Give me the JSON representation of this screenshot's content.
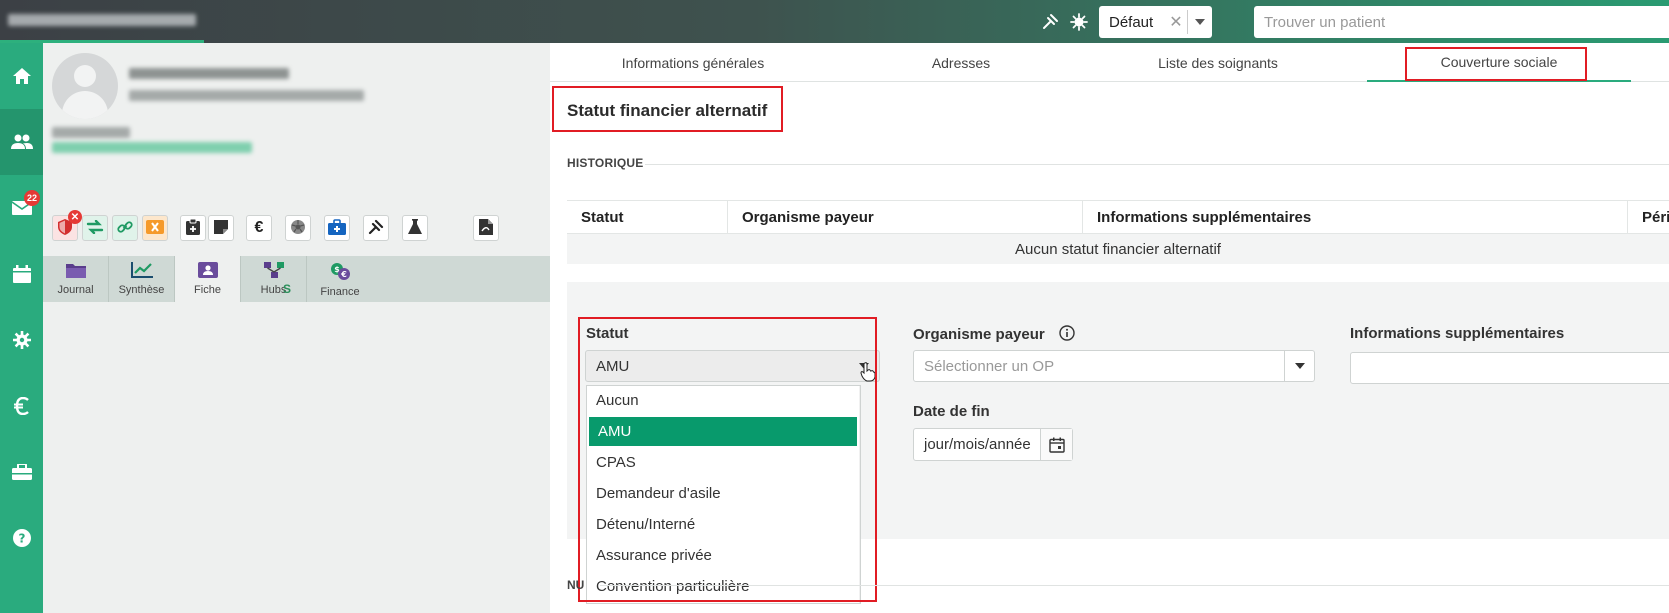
{
  "topbar": {
    "defaut_value": "Défaut",
    "patient_search_placeholder": "Trouver un patient"
  },
  "leftnav": {
    "items": [
      {
        "icon": "home-icon"
      },
      {
        "icon": "users-icon",
        "active": true
      },
      {
        "icon": "mail-icon",
        "badge": "22"
      },
      {
        "icon": "calendar-icon"
      },
      {
        "icon": "gear-icon"
      },
      {
        "icon": "euro-icon"
      },
      {
        "icon": "toolbox-icon"
      },
      {
        "icon": "help-icon"
      }
    ]
  },
  "patient_tabs": [
    {
      "label": "Journal",
      "icon": "folder-icon"
    },
    {
      "label": "Synthèse",
      "icon": "chart-icon"
    },
    {
      "label": "Fiche",
      "icon": "id-card-icon",
      "active": true
    },
    {
      "label": "Hubs",
      "icon": "hub-icon",
      "suffix": "S"
    },
    {
      "label": "Finance",
      "icon": "finance-icon"
    }
  ],
  "patient_actions": {
    "euro_label": "€",
    "shield_badge": "✕"
  },
  "main_tabs": [
    {
      "label": "Informations générales"
    },
    {
      "label": "Adresses"
    },
    {
      "label": "Liste des soignants"
    },
    {
      "label": "Couverture sociale",
      "active": true
    }
  ],
  "section": {
    "title": "Statut financier alternatif",
    "historique_label": "HISTORIQUE"
  },
  "history_table": {
    "columns": [
      "Statut",
      "Organisme payeur",
      "Informations supplémentaires",
      "Péri"
    ],
    "empty_message": "Aucun statut financier alternatif"
  },
  "form": {
    "statut_label": "Statut",
    "statut_value": "AMU",
    "organisme_label": "Organisme payeur",
    "organisme_placeholder": "Sélectionner un OP",
    "info_label": "Informations supplémentaires",
    "date_fin_label": "Date de fin",
    "date_fin_placeholder": "jour/mois/année"
  },
  "dropdown": {
    "options": [
      "Aucun",
      "AMU",
      "CPAS",
      "Demandeur d'asile",
      "Détenu/Interné",
      "Assurance privée",
      "Convention particulière"
    ],
    "selected": "AMU"
  },
  "next_section_label": "NU",
  "colors": {
    "accent": "#2aab7e",
    "selected_option": "#089a6c",
    "highlight_box": "#e11c24",
    "badge": "#e53935"
  }
}
